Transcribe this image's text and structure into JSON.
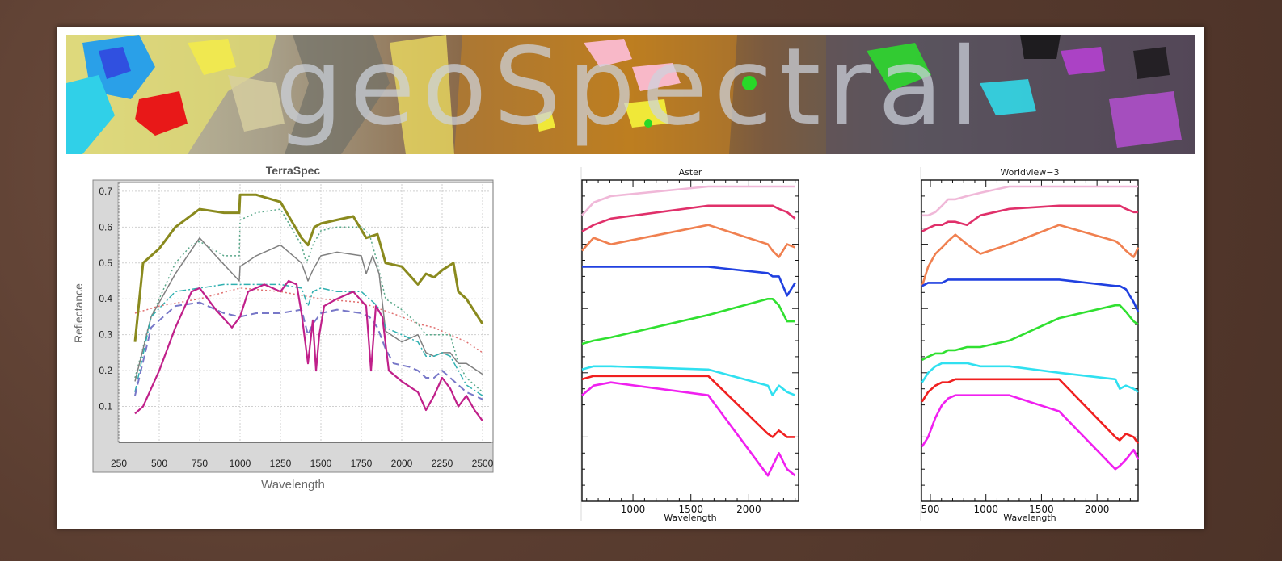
{
  "banner": {
    "title": "geoSpectral"
  },
  "chart_data": [
    {
      "type": "line",
      "title": "TerraSpec",
      "xlabel": "Wavelength",
      "ylabel": "Reflectance",
      "xlim": [
        250,
        2550
      ],
      "ylim": [
        0,
        0.72
      ],
      "xticks": [
        250,
        500,
        750,
        1000,
        1250,
        1500,
        1750,
        2000,
        2250,
        2500
      ],
      "yticks": [
        0.1,
        0.2,
        0.3,
        0.4,
        0.5,
        0.6,
        0.7
      ],
      "grid": true,
      "series": [
        {
          "color": "#8a8a1e",
          "style": "solid",
          "width": 3,
          "x": [
            350,
            400,
            500,
            600,
            750,
            900,
            995,
            1000,
            1100,
            1250,
            1380,
            1420,
            1460,
            1500,
            1600,
            1700,
            1780,
            1850,
            1900,
            2000,
            2100,
            2150,
            2200,
            2250,
            2320,
            2350,
            2400,
            2500
          ],
          "y": [
            0.28,
            0.5,
            0.54,
            0.6,
            0.65,
            0.64,
            0.64,
            0.69,
            0.69,
            0.67,
            0.57,
            0.55,
            0.6,
            0.61,
            0.62,
            0.63,
            0.57,
            0.58,
            0.5,
            0.49,
            0.44,
            0.47,
            0.46,
            0.48,
            0.5,
            0.42,
            0.4,
            0.33
          ]
        },
        {
          "color": "#5aa88a",
          "style": "dotted",
          "width": 1.5,
          "x": [
            350,
            450,
            600,
            700,
            750,
            900,
            995,
            1000,
            1100,
            1250,
            1380,
            1410,
            1450,
            1500,
            1600,
            1750,
            1800,
            1850,
            1900,
            2000,
            2100,
            2150,
            2200,
            2250,
            2300,
            2350,
            2400,
            2500
          ],
          "y": [
            0.18,
            0.35,
            0.5,
            0.55,
            0.56,
            0.52,
            0.52,
            0.62,
            0.64,
            0.65,
            0.55,
            0.5,
            0.55,
            0.59,
            0.6,
            0.6,
            0.58,
            0.5,
            0.4,
            0.37,
            0.33,
            0.3,
            0.3,
            0.3,
            0.3,
            0.22,
            0.18,
            0.14
          ]
        },
        {
          "color": "#808080",
          "style": "solid",
          "width": 1.5,
          "x": [
            350,
            450,
            600,
            750,
            850,
            995,
            1000,
            1100,
            1250,
            1380,
            1420,
            1450,
            1500,
            1600,
            1750,
            1780,
            1820,
            1860,
            1900,
            2000,
            2100,
            2150,
            2200,
            2250,
            2300,
            2350,
            2400,
            2500
          ],
          "y": [
            0.17,
            0.35,
            0.47,
            0.57,
            0.52,
            0.45,
            0.49,
            0.52,
            0.55,
            0.5,
            0.45,
            0.48,
            0.52,
            0.53,
            0.52,
            0.47,
            0.52,
            0.47,
            0.31,
            0.28,
            0.3,
            0.25,
            0.24,
            0.25,
            0.25,
            0.22,
            0.22,
            0.19
          ]
        },
        {
          "color": "#30b0b0",
          "style": "dashdot",
          "width": 1.5,
          "x": [
            350,
            450,
            600,
            750,
            900,
            1000,
            1100,
            1250,
            1380,
            1420,
            1450,
            1500,
            1600,
            1750,
            1800,
            1850,
            1900,
            2000,
            2100,
            2150,
            2200,
            2250,
            2300,
            2350,
            2400,
            2500
          ],
          "y": [
            0.14,
            0.35,
            0.42,
            0.43,
            0.44,
            0.44,
            0.44,
            0.44,
            0.43,
            0.38,
            0.42,
            0.43,
            0.42,
            0.42,
            0.4,
            0.38,
            0.32,
            0.3,
            0.28,
            0.24,
            0.24,
            0.25,
            0.24,
            0.2,
            0.16,
            0.13
          ]
        },
        {
          "color": "#e07070",
          "style": "dotted",
          "width": 1.5,
          "x": [
            350,
            500,
            750,
            1000,
            1250,
            1500,
            1750,
            2000,
            2100,
            2200,
            2300,
            2400,
            2500
          ],
          "y": [
            0.36,
            0.38,
            0.4,
            0.43,
            0.42,
            0.4,
            0.39,
            0.35,
            0.33,
            0.32,
            0.3,
            0.28,
            0.25
          ]
        },
        {
          "color": "#7878c8",
          "style": "dashed",
          "width": 2,
          "x": [
            350,
            450,
            600,
            750,
            900,
            1000,
            1100,
            1250,
            1380,
            1420,
            1450,
            1500,
            1600,
            1750,
            1800,
            1850,
            1900,
            1950,
            2050,
            2100,
            2150,
            2200,
            2250,
            2300,
            2350,
            2400,
            2500
          ],
          "y": [
            0.13,
            0.32,
            0.38,
            0.39,
            0.36,
            0.35,
            0.36,
            0.36,
            0.37,
            0.3,
            0.33,
            0.36,
            0.37,
            0.36,
            0.35,
            0.32,
            0.26,
            0.22,
            0.21,
            0.2,
            0.18,
            0.18,
            0.2,
            0.18,
            0.16,
            0.14,
            0.12
          ]
        },
        {
          "color": "#c0208a",
          "style": "solid",
          "width": 2.2,
          "x": [
            350,
            400,
            500,
            600,
            700,
            750,
            850,
            950,
            1000,
            1050,
            1150,
            1250,
            1300,
            1350,
            1380,
            1420,
            1450,
            1470,
            1490,
            1520,
            1600,
            1700,
            1780,
            1810,
            1840,
            1880,
            1920,
            2000,
            2100,
            2150,
            2200,
            2250,
            2300,
            2350,
            2400,
            2450,
            2500
          ],
          "y": [
            0.08,
            0.1,
            0.2,
            0.32,
            0.42,
            0.43,
            0.37,
            0.32,
            0.35,
            0.42,
            0.44,
            0.42,
            0.45,
            0.44,
            0.36,
            0.22,
            0.34,
            0.2,
            0.3,
            0.38,
            0.4,
            0.42,
            0.38,
            0.2,
            0.38,
            0.35,
            0.2,
            0.17,
            0.14,
            0.09,
            0.13,
            0.18,
            0.15,
            0.1,
            0.13,
            0.09,
            0.06
          ]
        }
      ]
    },
    {
      "type": "line",
      "title": "Aster",
      "xlabel": "Wavelength",
      "ylabel": "",
      "xlim": [
        560,
        2430
      ],
      "ylim": [
        0,
        1
      ],
      "xticks": [
        1000,
        1500,
        2000
      ],
      "yticks": [],
      "grid": false,
      "series": [
        {
          "color": "#f0b8d8",
          "x": [
            560,
            660,
            810,
            1650,
            2165,
            2205,
            2260,
            2330,
            2400
          ],
          "y": [
            0.89,
            0.93,
            0.95,
            0.98,
            0.98,
            0.98,
            0.98,
            0.98,
            0.98
          ]
        },
        {
          "color": "#e0306a",
          "x": [
            560,
            660,
            810,
            1650,
            2165,
            2205,
            2260,
            2330,
            2400
          ],
          "y": [
            0.84,
            0.86,
            0.88,
            0.92,
            0.92,
            0.92,
            0.91,
            0.9,
            0.88
          ]
        },
        {
          "color": "#f08050",
          "x": [
            560,
            660,
            810,
            1650,
            2165,
            2205,
            2260,
            2330,
            2400
          ],
          "y": [
            0.78,
            0.82,
            0.8,
            0.86,
            0.8,
            0.78,
            0.76,
            0.8,
            0.79
          ]
        },
        {
          "color": "#2040e0",
          "x": [
            560,
            660,
            810,
            1650,
            2165,
            2205,
            2260,
            2330,
            2400
          ],
          "y": [
            0.73,
            0.73,
            0.73,
            0.73,
            0.71,
            0.7,
            0.7,
            0.64,
            0.68
          ]
        },
        {
          "color": "#30e030",
          "x": [
            560,
            660,
            810,
            1650,
            2165,
            2205,
            2260,
            2330,
            2400
          ],
          "y": [
            0.49,
            0.5,
            0.51,
            0.58,
            0.63,
            0.63,
            0.61,
            0.56,
            0.56
          ]
        },
        {
          "color": "#30e0f0",
          "x": [
            560,
            660,
            810,
            1650,
            2165,
            2205,
            2260,
            2330,
            2400
          ],
          "y": [
            0.41,
            0.42,
            0.42,
            0.41,
            0.36,
            0.33,
            0.36,
            0.34,
            0.33
          ]
        },
        {
          "color": "#f02020",
          "x": [
            560,
            660,
            810,
            1650,
            2165,
            2205,
            2260,
            2330,
            2400
          ],
          "y": [
            0.38,
            0.39,
            0.39,
            0.39,
            0.21,
            0.2,
            0.22,
            0.2,
            0.2
          ]
        },
        {
          "color": "#f020f0",
          "x": [
            560,
            660,
            810,
            1650,
            2165,
            2205,
            2260,
            2330,
            2400
          ],
          "y": [
            0.33,
            0.36,
            0.37,
            0.33,
            0.08,
            0.11,
            0.15,
            0.1,
            0.08
          ]
        }
      ]
    },
    {
      "type": "line",
      "title": "Worldview−3",
      "xlabel": "Wavelength",
      "ylabel": "",
      "xlim": [
        420,
        2370
      ],
      "ylim": [
        0,
        1
      ],
      "xticks": [
        500,
        1000,
        1500,
        2000
      ],
      "yticks": [],
      "grid": false,
      "series": [
        {
          "color": "#f0b8d8",
          "x": [
            425,
            480,
            545,
            605,
            660,
            725,
            830,
            950,
            1210,
            1660,
            2165,
            2205,
            2260,
            2330,
            2370
          ],
          "y": [
            0.89,
            0.89,
            0.9,
            0.92,
            0.94,
            0.94,
            0.95,
            0.96,
            0.98,
            0.98,
            0.98,
            0.98,
            0.98,
            0.98,
            0.98
          ]
        },
        {
          "color": "#e0306a",
          "x": [
            425,
            480,
            545,
            605,
            660,
            725,
            830,
            950,
            1210,
            1660,
            2165,
            2205,
            2260,
            2330,
            2370
          ],
          "y": [
            0.84,
            0.85,
            0.86,
            0.86,
            0.87,
            0.87,
            0.86,
            0.89,
            0.91,
            0.92,
            0.92,
            0.92,
            0.91,
            0.9,
            0.9
          ]
        },
        {
          "color": "#f08050",
          "x": [
            425,
            480,
            545,
            605,
            660,
            725,
            830,
            950,
            1210,
            1660,
            2165,
            2205,
            2260,
            2330,
            2370
          ],
          "y": [
            0.67,
            0.73,
            0.77,
            0.79,
            0.81,
            0.83,
            0.8,
            0.77,
            0.8,
            0.86,
            0.81,
            0.8,
            0.78,
            0.76,
            0.79
          ]
        },
        {
          "color": "#2040e0",
          "x": [
            425,
            480,
            545,
            605,
            660,
            725,
            830,
            950,
            1210,
            1660,
            2165,
            2205,
            2260,
            2330,
            2370
          ],
          "y": [
            0.67,
            0.68,
            0.68,
            0.68,
            0.69,
            0.69,
            0.69,
            0.69,
            0.69,
            0.69,
            0.67,
            0.67,
            0.66,
            0.62,
            0.59
          ]
        },
        {
          "color": "#30e030",
          "x": [
            425,
            480,
            545,
            605,
            660,
            725,
            830,
            950,
            1210,
            1660,
            2165,
            2205,
            2260,
            2330,
            2370
          ],
          "y": [
            0.44,
            0.45,
            0.46,
            0.46,
            0.47,
            0.47,
            0.48,
            0.48,
            0.5,
            0.57,
            0.61,
            0.61,
            0.59,
            0.56,
            0.55
          ]
        },
        {
          "color": "#30e0f0",
          "x": [
            425,
            480,
            545,
            605,
            660,
            725,
            830,
            950,
            1210,
            1660,
            2165,
            2205,
            2260,
            2330,
            2370
          ],
          "y": [
            0.37,
            0.4,
            0.42,
            0.43,
            0.43,
            0.43,
            0.43,
            0.42,
            0.42,
            0.4,
            0.38,
            0.35,
            0.36,
            0.35,
            0.34
          ]
        },
        {
          "color": "#f02020",
          "x": [
            425,
            480,
            545,
            605,
            660,
            725,
            830,
            950,
            1210,
            1660,
            2165,
            2205,
            2260,
            2330,
            2370
          ],
          "y": [
            0.31,
            0.34,
            0.36,
            0.37,
            0.37,
            0.38,
            0.38,
            0.38,
            0.38,
            0.38,
            0.2,
            0.19,
            0.21,
            0.2,
            0.18
          ]
        },
        {
          "color": "#f020f0",
          "x": [
            425,
            480,
            545,
            605,
            660,
            725,
            830,
            950,
            1210,
            1660,
            2165,
            2205,
            2260,
            2330,
            2370
          ],
          "y": [
            0.17,
            0.2,
            0.26,
            0.3,
            0.32,
            0.33,
            0.33,
            0.33,
            0.33,
            0.28,
            0.1,
            0.11,
            0.13,
            0.16,
            0.13
          ]
        }
      ]
    }
  ]
}
